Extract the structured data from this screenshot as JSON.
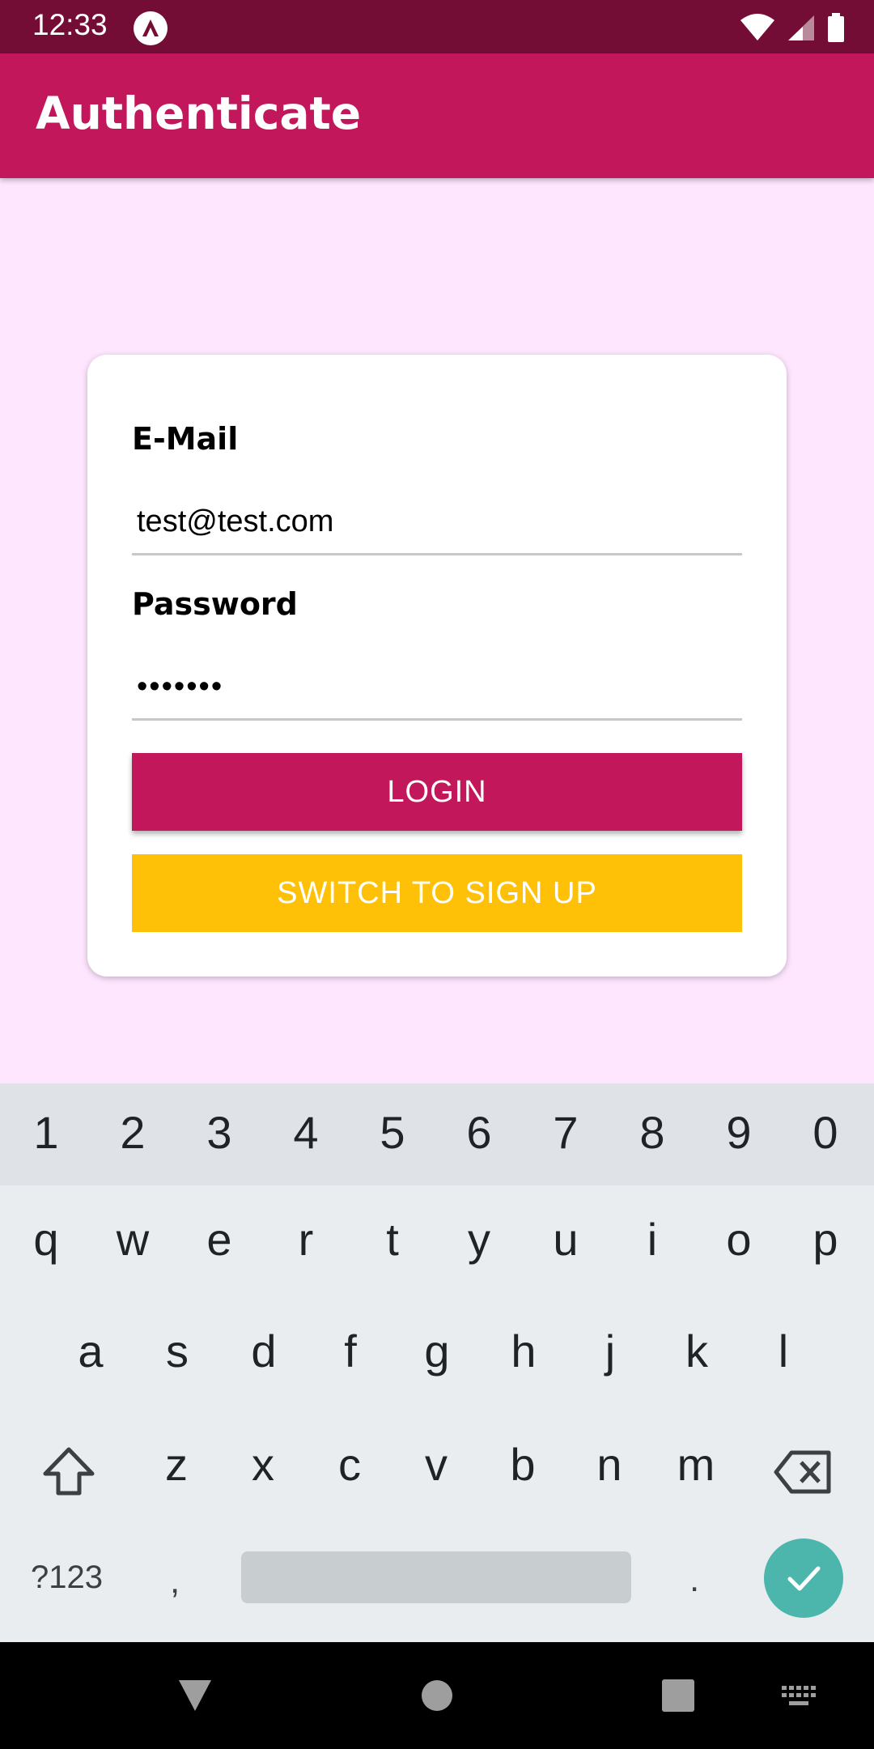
{
  "status_bar": {
    "time": "12:33"
  },
  "app_bar": {
    "title": "Authenticate"
  },
  "form": {
    "email_label": "E-Mail",
    "email_value": "test@test.com",
    "password_label": "Password",
    "password_value": "•••••••",
    "login_label": "LOGIN",
    "switch_label": "SWITCH TO SIGN UP"
  },
  "keyboard": {
    "row_numbers": [
      "1",
      "2",
      "3",
      "4",
      "5",
      "6",
      "7",
      "8",
      "9",
      "0"
    ],
    "row1": [
      "q",
      "w",
      "e",
      "r",
      "t",
      "y",
      "u",
      "i",
      "o",
      "p"
    ],
    "row2": [
      "a",
      "s",
      "d",
      "f",
      "g",
      "h",
      "j",
      "k",
      "l"
    ],
    "row3": [
      "z",
      "x",
      "c",
      "v",
      "b",
      "n",
      "m"
    ],
    "symbols_label": "?123",
    "comma": ",",
    "period": "."
  },
  "colors": {
    "primary": "#C2185B",
    "status_bar": "#740D36",
    "accent": "#FFC107",
    "background": "#FFE6FF",
    "enter_key": "#4DB6AC"
  },
  "icons": {
    "status": [
      "app-notification-icon",
      "wifi-icon",
      "signal-icon",
      "battery-icon"
    ],
    "keyboard": [
      "shift-icon",
      "backspace-icon",
      "check-icon"
    ],
    "navigation": [
      "back-icon",
      "home-icon",
      "recents-icon",
      "keyboard-switch-icon"
    ]
  }
}
